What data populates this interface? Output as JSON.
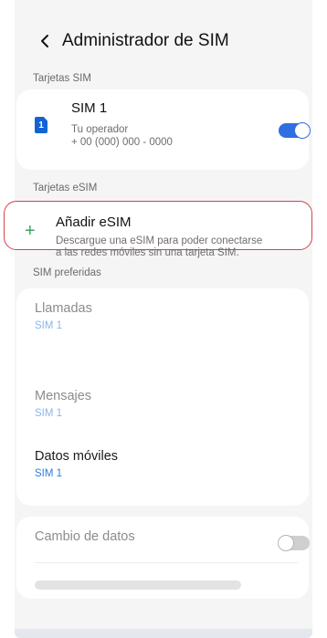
{
  "header": {
    "title": "Administrador de SIM",
    "back_icon": "chevron-left-icon"
  },
  "sections": {
    "sim_cards": "Tarjetas SIM",
    "esim_cards": "Tarjetas eSIM",
    "preferred": "SIM preferidas"
  },
  "sim1": {
    "name": "SIM 1",
    "badge": "1",
    "operator": "Tu operador",
    "number": "+ 00 (000) 000 - 0000",
    "enabled": true,
    "accent": "#2f6fe0"
  },
  "esim": {
    "title": "Añadir eSIM",
    "description_line1": "Descargue una eSIM para poder conectarse",
    "description_line2": "a las redes móviles sin una tarjeta SIM.",
    "plus_icon": "+",
    "highlight_color": "#d3434f"
  },
  "preferred": {
    "calls": {
      "title": "Llamadas",
      "value": "SIM 1"
    },
    "messages": {
      "title": "Mensajes",
      "value": "SIM 1"
    },
    "mobile_data": {
      "title": "Datos móviles",
      "value": "SIM 1"
    }
  },
  "data_switch": {
    "title": "Cambio de datos",
    "enabled": false
  }
}
